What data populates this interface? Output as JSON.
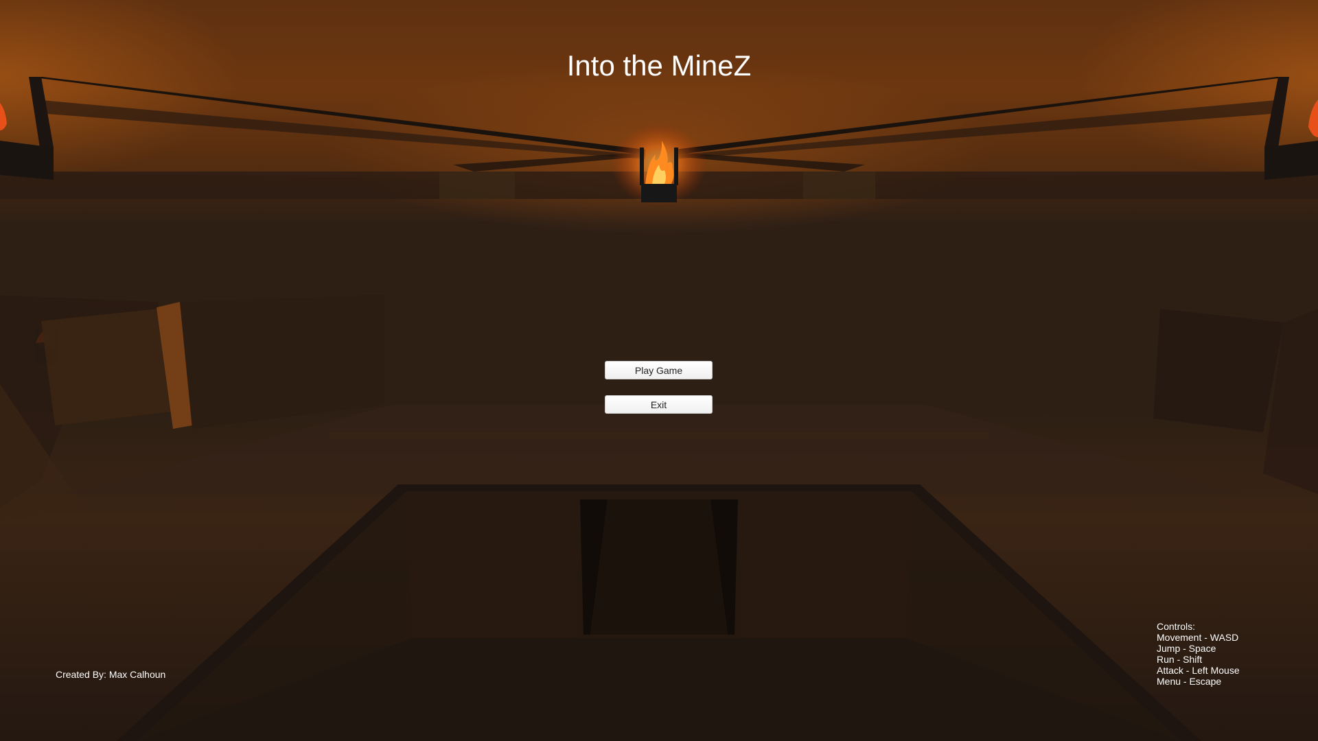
{
  "title": "Into the MineZ",
  "menu": {
    "play_label": "Play Game",
    "exit_label": "Exit"
  },
  "credit": "Created By: Max Calhoun",
  "controls": {
    "heading": "Controls:",
    "items": [
      "Movement - WASD",
      "Jump - Space",
      "Run - Shift",
      "Attack - Left Mouse",
      "Menu - Escape"
    ]
  },
  "colors": {
    "torch_fire": "#ff7a1a",
    "text": "#ffffff",
    "button_bg": "#f5f5f5"
  }
}
